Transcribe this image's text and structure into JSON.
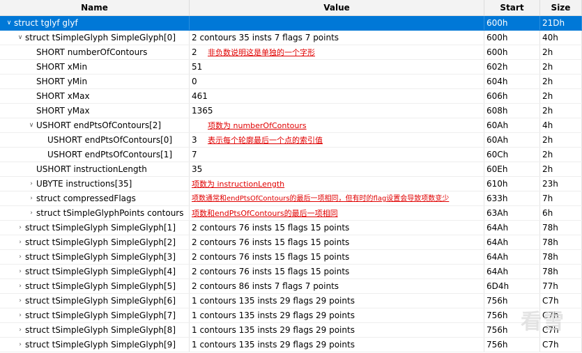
{
  "columns": {
    "name": "Name",
    "value": "Value",
    "start": "Start",
    "size": "Size"
  },
  "rows": [
    {
      "name": "struct tglyf glyf",
      "value": "",
      "start": "600h",
      "size": "21Dh",
      "toggle": "expanded"
    },
    {
      "name": "struct tSimpleGlyph SimpleGlyph[0]",
      "value": "2 contours 35 insts 7 flags 7 points",
      "start": "600h",
      "size": "40h",
      "toggle": "expanded"
    },
    {
      "name": "SHORT numberOfContours",
      "value": "2",
      "start": "600h",
      "size": "2h",
      "toggle": "none",
      "note": "非负数说明这是单独的一个字形"
    },
    {
      "name": "SHORT xMin",
      "value": "51",
      "start": "602h",
      "size": "2h",
      "toggle": "none"
    },
    {
      "name": "SHORT yMin",
      "value": "0",
      "start": "604h",
      "size": "2h",
      "toggle": "none"
    },
    {
      "name": "SHORT xMax",
      "value": "461",
      "start": "606h",
      "size": "2h",
      "toggle": "none"
    },
    {
      "name": "SHORT yMax",
      "value": "1365",
      "start": "608h",
      "size": "2h",
      "toggle": "none"
    },
    {
      "name": "USHORT endPtsOfContours[2]",
      "value": "",
      "start": "60Ah",
      "size": "4h",
      "toggle": "expanded",
      "note": "项数为 numberOfContours"
    },
    {
      "name": "USHORT endPtsOfContours[0]",
      "value": "3",
      "start": "60Ah",
      "size": "2h",
      "toggle": "none",
      "note": "表示每个轮廓最后一个点的索引值"
    },
    {
      "name": "USHORT endPtsOfContours[1]",
      "value": "7",
      "start": "60Ch",
      "size": "2h",
      "toggle": "none"
    },
    {
      "name": "USHORT instructionLength",
      "value": "35",
      "start": "60Eh",
      "size": "2h",
      "toggle": "none"
    },
    {
      "name": "UBYTE instructions[35]",
      "value": "",
      "start": "610h",
      "size": "23h",
      "toggle": "collapsed",
      "note": "项数为 instructionLength"
    },
    {
      "name": "struct compressedFlags",
      "value": "",
      "start": "633h",
      "size": "7h",
      "toggle": "collapsed",
      "note": "项数通常和endPtsOfContours的最后一项相同，但有时的flag设置会导致项数变少"
    },
    {
      "name": "struct tSimpleGlyphPoints contours",
      "value": "",
      "start": "63Ah",
      "size": "6h",
      "toggle": "collapsed",
      "note": "项数和endPtsOfContours的最后一项相同"
    },
    {
      "name": "struct tSimpleGlyph SimpleGlyph[1]",
      "value": "2 contours 76 insts 15 flags 15 points",
      "start": "64Ah",
      "size": "78h",
      "toggle": "collapsed"
    },
    {
      "name": "struct tSimpleGlyph SimpleGlyph[2]",
      "value": "2 contours 76 insts 15 flags 15 points",
      "start": "64Ah",
      "size": "78h",
      "toggle": "collapsed"
    },
    {
      "name": "struct tSimpleGlyph SimpleGlyph[3]",
      "value": "2 contours 76 insts 15 flags 15 points",
      "start": "64Ah",
      "size": "78h",
      "toggle": "collapsed"
    },
    {
      "name": "struct tSimpleGlyph SimpleGlyph[4]",
      "value": "2 contours 76 insts 15 flags 15 points",
      "start": "64Ah",
      "size": "78h",
      "toggle": "collapsed"
    },
    {
      "name": "struct tSimpleGlyph SimpleGlyph[5]",
      "value": "2 contours 86 insts 7 flags 7 points",
      "start": "6D4h",
      "size": "77h",
      "toggle": "collapsed"
    },
    {
      "name": "struct tSimpleGlyph SimpleGlyph[6]",
      "value": "1 contours 135 insts 29 flags 29 points",
      "start": "756h",
      "size": "C7h",
      "toggle": "collapsed"
    },
    {
      "name": "struct tSimpleGlyph SimpleGlyph[7]",
      "value": "1 contours 135 insts 29 flags 29 points",
      "start": "756h",
      "size": "C7h",
      "toggle": "collapsed"
    },
    {
      "name": "struct tSimpleGlyph SimpleGlyph[8]",
      "value": "1 contours 135 insts 29 flags 29 points",
      "start": "756h",
      "size": "C7h",
      "toggle": "collapsed"
    },
    {
      "name": "struct tSimpleGlyph SimpleGlyph[9]",
      "value": "1 contours 135 insts 29 flags 29 points",
      "start": "756h",
      "size": "C7h",
      "toggle": "collapsed"
    }
  ],
  "watermark": "看雪",
  "colors": {
    "selection": "#0078d7",
    "annotation": "#e00000"
  },
  "icons": {
    "expanded": "chevron-down-icon",
    "collapsed": "chevron-right-icon"
  }
}
